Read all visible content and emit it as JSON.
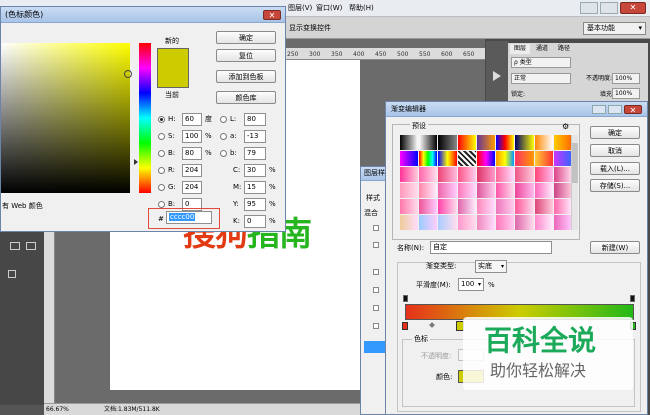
{
  "menubar": {
    "items": [
      "图层(V)",
      "窗口(W)",
      "帮助(H)"
    ]
  },
  "optionsbar": {
    "show_transform": "显示变换控件",
    "workspace": "基本功能"
  },
  "ruler": {
    "ticks": [
      "250",
      "300",
      "350",
      "400",
      "450",
      "500",
      "550",
      "600",
      "650",
      "700",
      "750",
      "800",
      "850"
    ]
  },
  "status": {
    "zoom": "66.67%",
    "doc": "文档:1.83M/511.8K"
  },
  "canvas_text": {
    "part1": "搜狗",
    "part2": "指南"
  },
  "color_picker": {
    "title": "(色标颜色)",
    "new_label": "新的",
    "current_label": "当前",
    "new_color": "#cccc00",
    "buttons": {
      "ok": "确定",
      "reset": "复位",
      "add_swatch": "添加到色板",
      "libraries": "颜色库"
    },
    "web_only": "有 Web 颜色",
    "fields": {
      "H": {
        "label": "H:",
        "value": "60",
        "unit": "度"
      },
      "S": {
        "label": "S:",
        "value": "100",
        "unit": "%"
      },
      "B": {
        "label": "B:",
        "value": "80",
        "unit": "%"
      },
      "R": {
        "label": "R:",
        "value": "204"
      },
      "G": {
        "label": "G:",
        "value": "204"
      },
      "Bl": {
        "label": "B:",
        "value": "0"
      },
      "L": {
        "label": "L:",
        "value": "80"
      },
      "a": {
        "label": "a:",
        "value": "-13"
      },
      "b": {
        "label": "b:",
        "value": "79"
      },
      "C": {
        "label": "C:",
        "value": "30",
        "unit": "%"
      },
      "M": {
        "label": "M:",
        "value": "15",
        "unit": "%"
      },
      "Y": {
        "label": "Y:",
        "value": "95",
        "unit": "%"
      },
      "K": {
        "label": "K:",
        "value": "0",
        "unit": "%"
      }
    },
    "hex_label": "#",
    "hex_value": "cccc00"
  },
  "layer_style": {
    "title": "图层样",
    "label1": "样式",
    "label2": "混合"
  },
  "layers_panel": {
    "tabs": [
      "图层",
      "通道",
      "路径"
    ],
    "kind": "ρ 类型",
    "mode": "正常",
    "opacity_label": "不透明度:",
    "opacity": "100%",
    "lock_label": "锁定:",
    "fill_label": "填充:",
    "fill": "100%"
  },
  "gradient_editor": {
    "title": "渐变编辑器",
    "presets_label": "预设",
    "buttons": {
      "ok": "确定",
      "cancel": "取消",
      "load": "载入(L)...",
      "save": "存储(S)...",
      "new": "新建(W)"
    },
    "name_label": "名称(N):",
    "name_value": "自定",
    "type_label": "渐变类型:",
    "type_value": "实底",
    "smoothness_label": "平滑度(M):",
    "smoothness_value": "100",
    "smoothness_unit": "%",
    "stops_label": "色标",
    "opacity_label": "不透明度:",
    "color_label": "颜色:",
    "stop_color": "#cccc00"
  },
  "watermark": {
    "main": "百科全说",
    "sub": "助你轻松解决"
  }
}
